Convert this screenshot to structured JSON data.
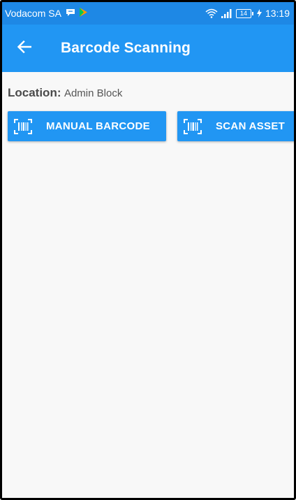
{
  "status_bar": {
    "carrier": "Vodacom SA",
    "battery": "14",
    "time": "13:19"
  },
  "app_bar": {
    "title": "Barcode Scanning"
  },
  "location": {
    "label": "Location:",
    "value": "Admin Block"
  },
  "actions": {
    "manual_barcode_label": "MANUAL BARCODE",
    "scan_asset_label": "SCAN ASSET"
  },
  "colors": {
    "primary": "#2196f3",
    "status_bar": "#1e88e5",
    "background": "#f8f8f8"
  }
}
